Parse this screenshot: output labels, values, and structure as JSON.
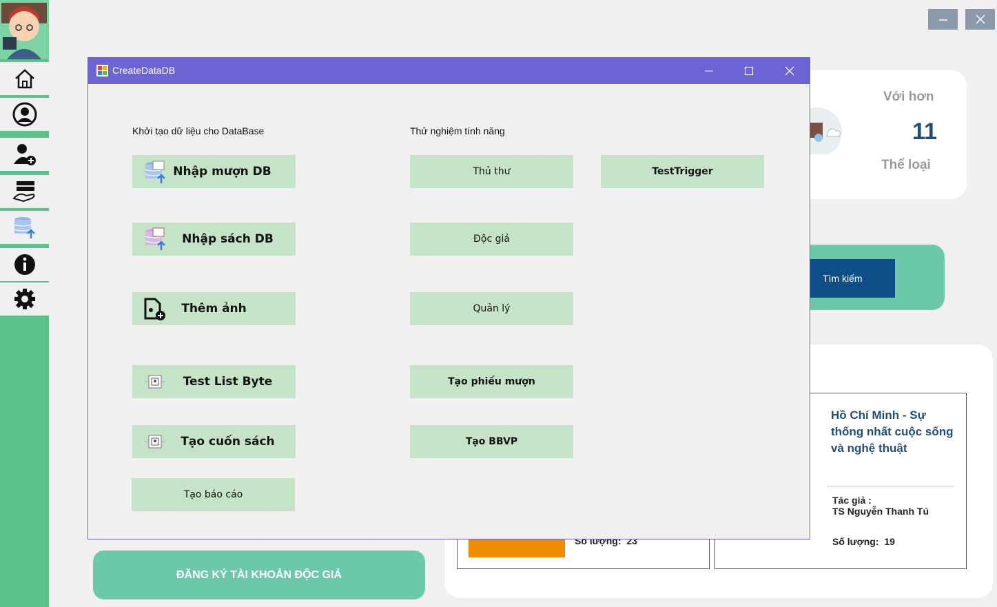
{
  "window_title": "CreateDataDB",
  "sidebar": {
    "items": [
      {
        "icon": "home-icon"
      },
      {
        "icon": "user-icon"
      },
      {
        "icon": "add-user-icon"
      },
      {
        "icon": "borrow-book-icon"
      },
      {
        "icon": "database-upload-icon"
      },
      {
        "icon": "info-icon"
      },
      {
        "icon": "gear-icon"
      }
    ]
  },
  "background": {
    "stats_card": {
      "line1": "Với hơn",
      "count": "11",
      "line2": "Thể loại"
    },
    "search_button": "Tìm kiếm",
    "register_button": "ĐĂNG KÝ TÀI KHOẢN ĐỘC GIẢ",
    "book_left": {
      "qty_label": "Số lượng:",
      "qty": "23"
    },
    "book_right": {
      "title": "Hồ Chí Minh - Sự thống nhất cuộc sống và nghệ thuật",
      "author_label": "Tác giả :",
      "author": "TS Nguyễn Thanh Tú",
      "qty_label": "Số lượng:",
      "qty": "19"
    }
  },
  "dialog": {
    "left_section_label": "Khởi tạo dữ liệu cho DataBase",
    "right_section_label": "Thử nghiệm tính năng",
    "left_buttons": {
      "nhap_muon": "Nhập mượn DB",
      "nhap_sach": "Nhập sách DB",
      "them_anh": "Thêm ảnh",
      "test_list_byte": "Test List Byte",
      "tao_cuon_sach": "Tạo cuốn sách",
      "tao_bao_cao": "Tạo báo cáo"
    },
    "right_buttons": {
      "thu_thu": "Thủ thư",
      "test_trigger": "TestTrigger",
      "doc_gia": "Độc giả",
      "quan_ly": "Quản lý",
      "tao_phieu_muon": "Tạo phiếu mượn",
      "tao_bbvp": "Tạo BBVP"
    }
  },
  "colors": {
    "sidebar": "#5bc08a",
    "titlebar": "#6c63d6",
    "button_bg": "#c5e3c7",
    "search_bg": "#0e4f8a",
    "book_title": "#1f4e79"
  }
}
